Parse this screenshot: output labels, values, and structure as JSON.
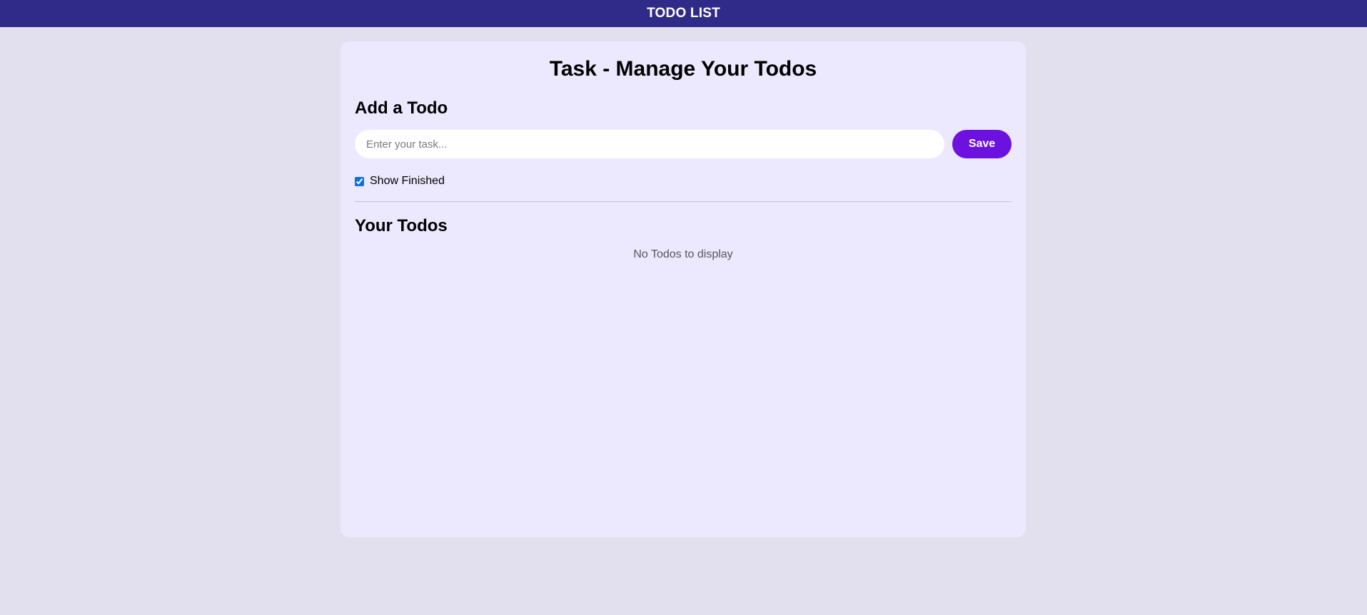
{
  "navbar": {
    "title": "TODO LIST"
  },
  "main": {
    "title": "Task - Manage Your Todos",
    "add_section": {
      "heading": "Add a Todo",
      "input_placeholder": "Enter your task...",
      "input_value": "",
      "save_label": "Save"
    },
    "show_finished": {
      "label": "Show Finished",
      "checked": true
    },
    "todos_section": {
      "heading": "Your Todos",
      "empty_message": "No Todos to display",
      "items": []
    }
  },
  "colors": {
    "navbar_bg": "#302b89",
    "page_bg": "#e2e0ee",
    "card_bg": "#ece9fe",
    "save_button_bg": "#6c11e0",
    "checkbox_accent": "#0b6fe8"
  }
}
